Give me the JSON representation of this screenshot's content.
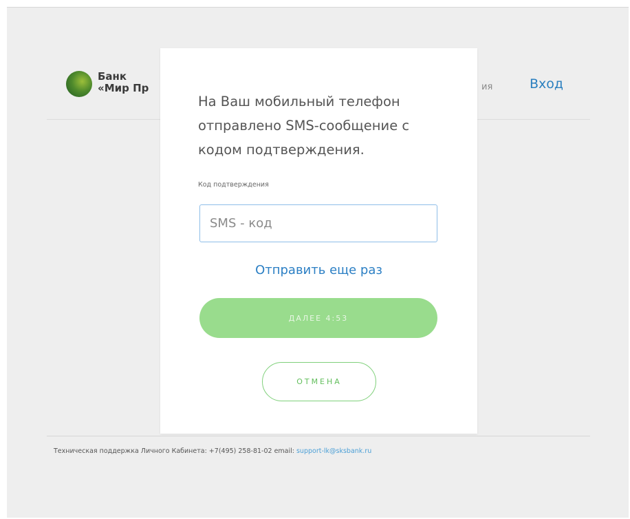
{
  "header": {
    "bank_name_line1": "Банк",
    "bank_name_line2": "«Мир Пр",
    "nav_partial": "ия",
    "login_label": "Вход"
  },
  "modal": {
    "message": "На Ваш мобильный телефон отправлено SMS-сообщение с кодом подтверждения.",
    "field_label": "Код подтверждения",
    "input_value": "",
    "input_placeholder": "SMS - код",
    "resend_label": "Отправить еще раз",
    "next_label": "ДАЛЕЕ 4:53",
    "cancel_label": "ОТМЕНА"
  },
  "footer": {
    "support_text": "Техническая поддержка Личного Кабинета: +7(495) 258-81-02 email: ",
    "support_email": "support-lk@sksbank.ru"
  },
  "colors": {
    "accent_blue": "#2b7fc4",
    "button_green": "#99dc8d",
    "outline_green": "#7fd07a"
  }
}
